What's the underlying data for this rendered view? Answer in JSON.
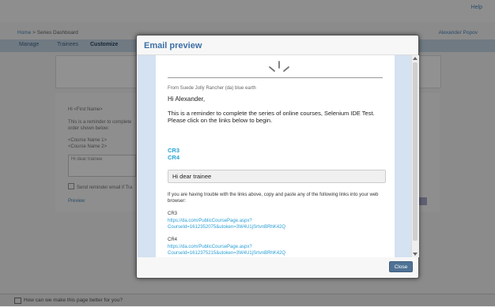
{
  "background": {
    "help_link": "Help",
    "breadcrumb": {
      "home": "Home",
      "sep": ">",
      "current": "Series Dashboard"
    },
    "user_menu": "Alexander Popov",
    "tabs": [
      "Manage",
      "Trainees",
      "Customize"
    ],
    "lines": [
      "Hi <First Name>",
      "This is a reminder to complete",
      "order shown below:",
      "<Course Name 1>",
      "<Course Name 2>"
    ],
    "textbox": "Hi dear trainee",
    "checkbox_label": "Send reminder email if Tra",
    "preview_link": "Preview",
    "feedback": "How can we make this page better for you?"
  },
  "modal": {
    "title": "Email preview",
    "close_label": "Close",
    "email": {
      "from": "From Suede Jolly Rancher (da) blue earth",
      "greeting": "Hi Alexander,",
      "body": "This is a reminder to complete the series of online courses, Selenium IDE Test. Please click on the links below to begin.",
      "course_links": [
        "CR3",
        "CR4"
      ],
      "custom_message": "Hi dear trainee",
      "trouble_text": "If you are having trouble with the links above, copy and paste any of the following links into your web browser:",
      "courses": [
        {
          "name": "CR3",
          "url_line1": "https://da.com/PublicCoursePage.aspx?",
          "url_line2": "CourseId=1612352075&utoken=3W4U1jSrtvnBRhK42Q"
        },
        {
          "name": "CR4",
          "url_line1": "https://da.com/PublicCoursePage.aspx?",
          "url_line2": "CourseId=1612375215&utoken=3W4U1jSrtvnBRhK42Q"
        }
      ]
    }
  },
  "colors": {
    "accent": "#3d6fa8",
    "link": "#2a9fd6",
    "button": "#4f7294",
    "content_bg": "#d4e2f1"
  }
}
